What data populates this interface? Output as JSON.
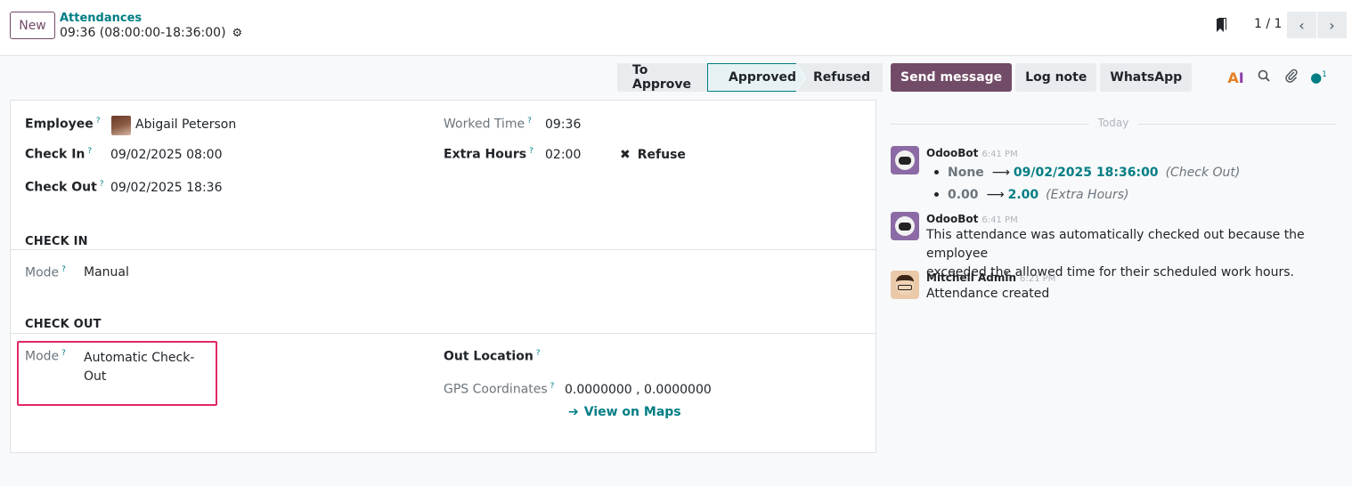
{
  "control_panel": {
    "new_button": "New",
    "breadcrumb_parent": "Attendances",
    "breadcrumb_current": "09:36 (08:00:00-18:36:00)",
    "pager_value": "1 / 1"
  },
  "statusbar": {
    "stages": [
      "To Approve",
      "Approved",
      "Refused"
    ],
    "active": "Approved",
    "active_color": "#017e84"
  },
  "form": {
    "employee_label": "Employee",
    "employee_value": "Abigail Peterson",
    "check_in_label": "Check In",
    "check_in_value": "09/02/2025 08:00",
    "check_out_label": "Check Out",
    "check_out_value": "09/02/2025 18:36",
    "worked_time_label": "Worked Time",
    "worked_time_value": "09:36",
    "extra_hours_label": "Extra Hours",
    "extra_hours_value": "02:00",
    "refuse_label": "Refuse",
    "help_mark": "?",
    "check_in_section": "CHECK IN",
    "check_in_mode_label": "Mode",
    "check_in_mode_value": "Manual",
    "check_out_section": "CHECK OUT",
    "check_out_mode_label": "Mode",
    "check_out_mode_value_line1": "Automatic Check-",
    "check_out_mode_value_line2": "Out",
    "out_location_label": "Out Location",
    "gps_label": "GPS Coordinates",
    "gps_value": "0.0000000 , 0.0000000",
    "view_maps": "View on Maps"
  },
  "chatter": {
    "send_message": "Send message",
    "log_note": "Log note",
    "whatsapp": "WhatsApp",
    "followers_count": "1",
    "today_label": "Today",
    "messages": [
      {
        "author": "OdooBot",
        "time": "6:41 PM",
        "tracking": [
          {
            "old": "None",
            "new": "09/02/2025 18:36:00",
            "field": "(Check Out)"
          },
          {
            "old": "0.00",
            "new": "2.00",
            "field": "(Extra Hours)"
          }
        ]
      },
      {
        "author": "OdooBot",
        "time": "6:41 PM",
        "text_line1": "This attendance was automatically checked out because the employee",
        "text_line2": "exceeded the allowed time for their scheduled work hours."
      },
      {
        "author": "Mitchell Admin",
        "time": "6:21 PM",
        "text": "Attendance created"
      }
    ]
  },
  "colors": {
    "brand": "#714b67",
    "accent": "#017e84",
    "highlight": "#e0286a"
  },
  "icons": {
    "gear": "gear-icon",
    "bookmark": "bookmark-icon",
    "prev": "chevron-left-icon",
    "next": "chevron-right-icon",
    "refuse": "close-icon",
    "maps": "arrow-right-icon",
    "ai": "ai-icon",
    "search": "search-icon",
    "attachment": "paperclip-icon",
    "followers": "user-icon"
  }
}
